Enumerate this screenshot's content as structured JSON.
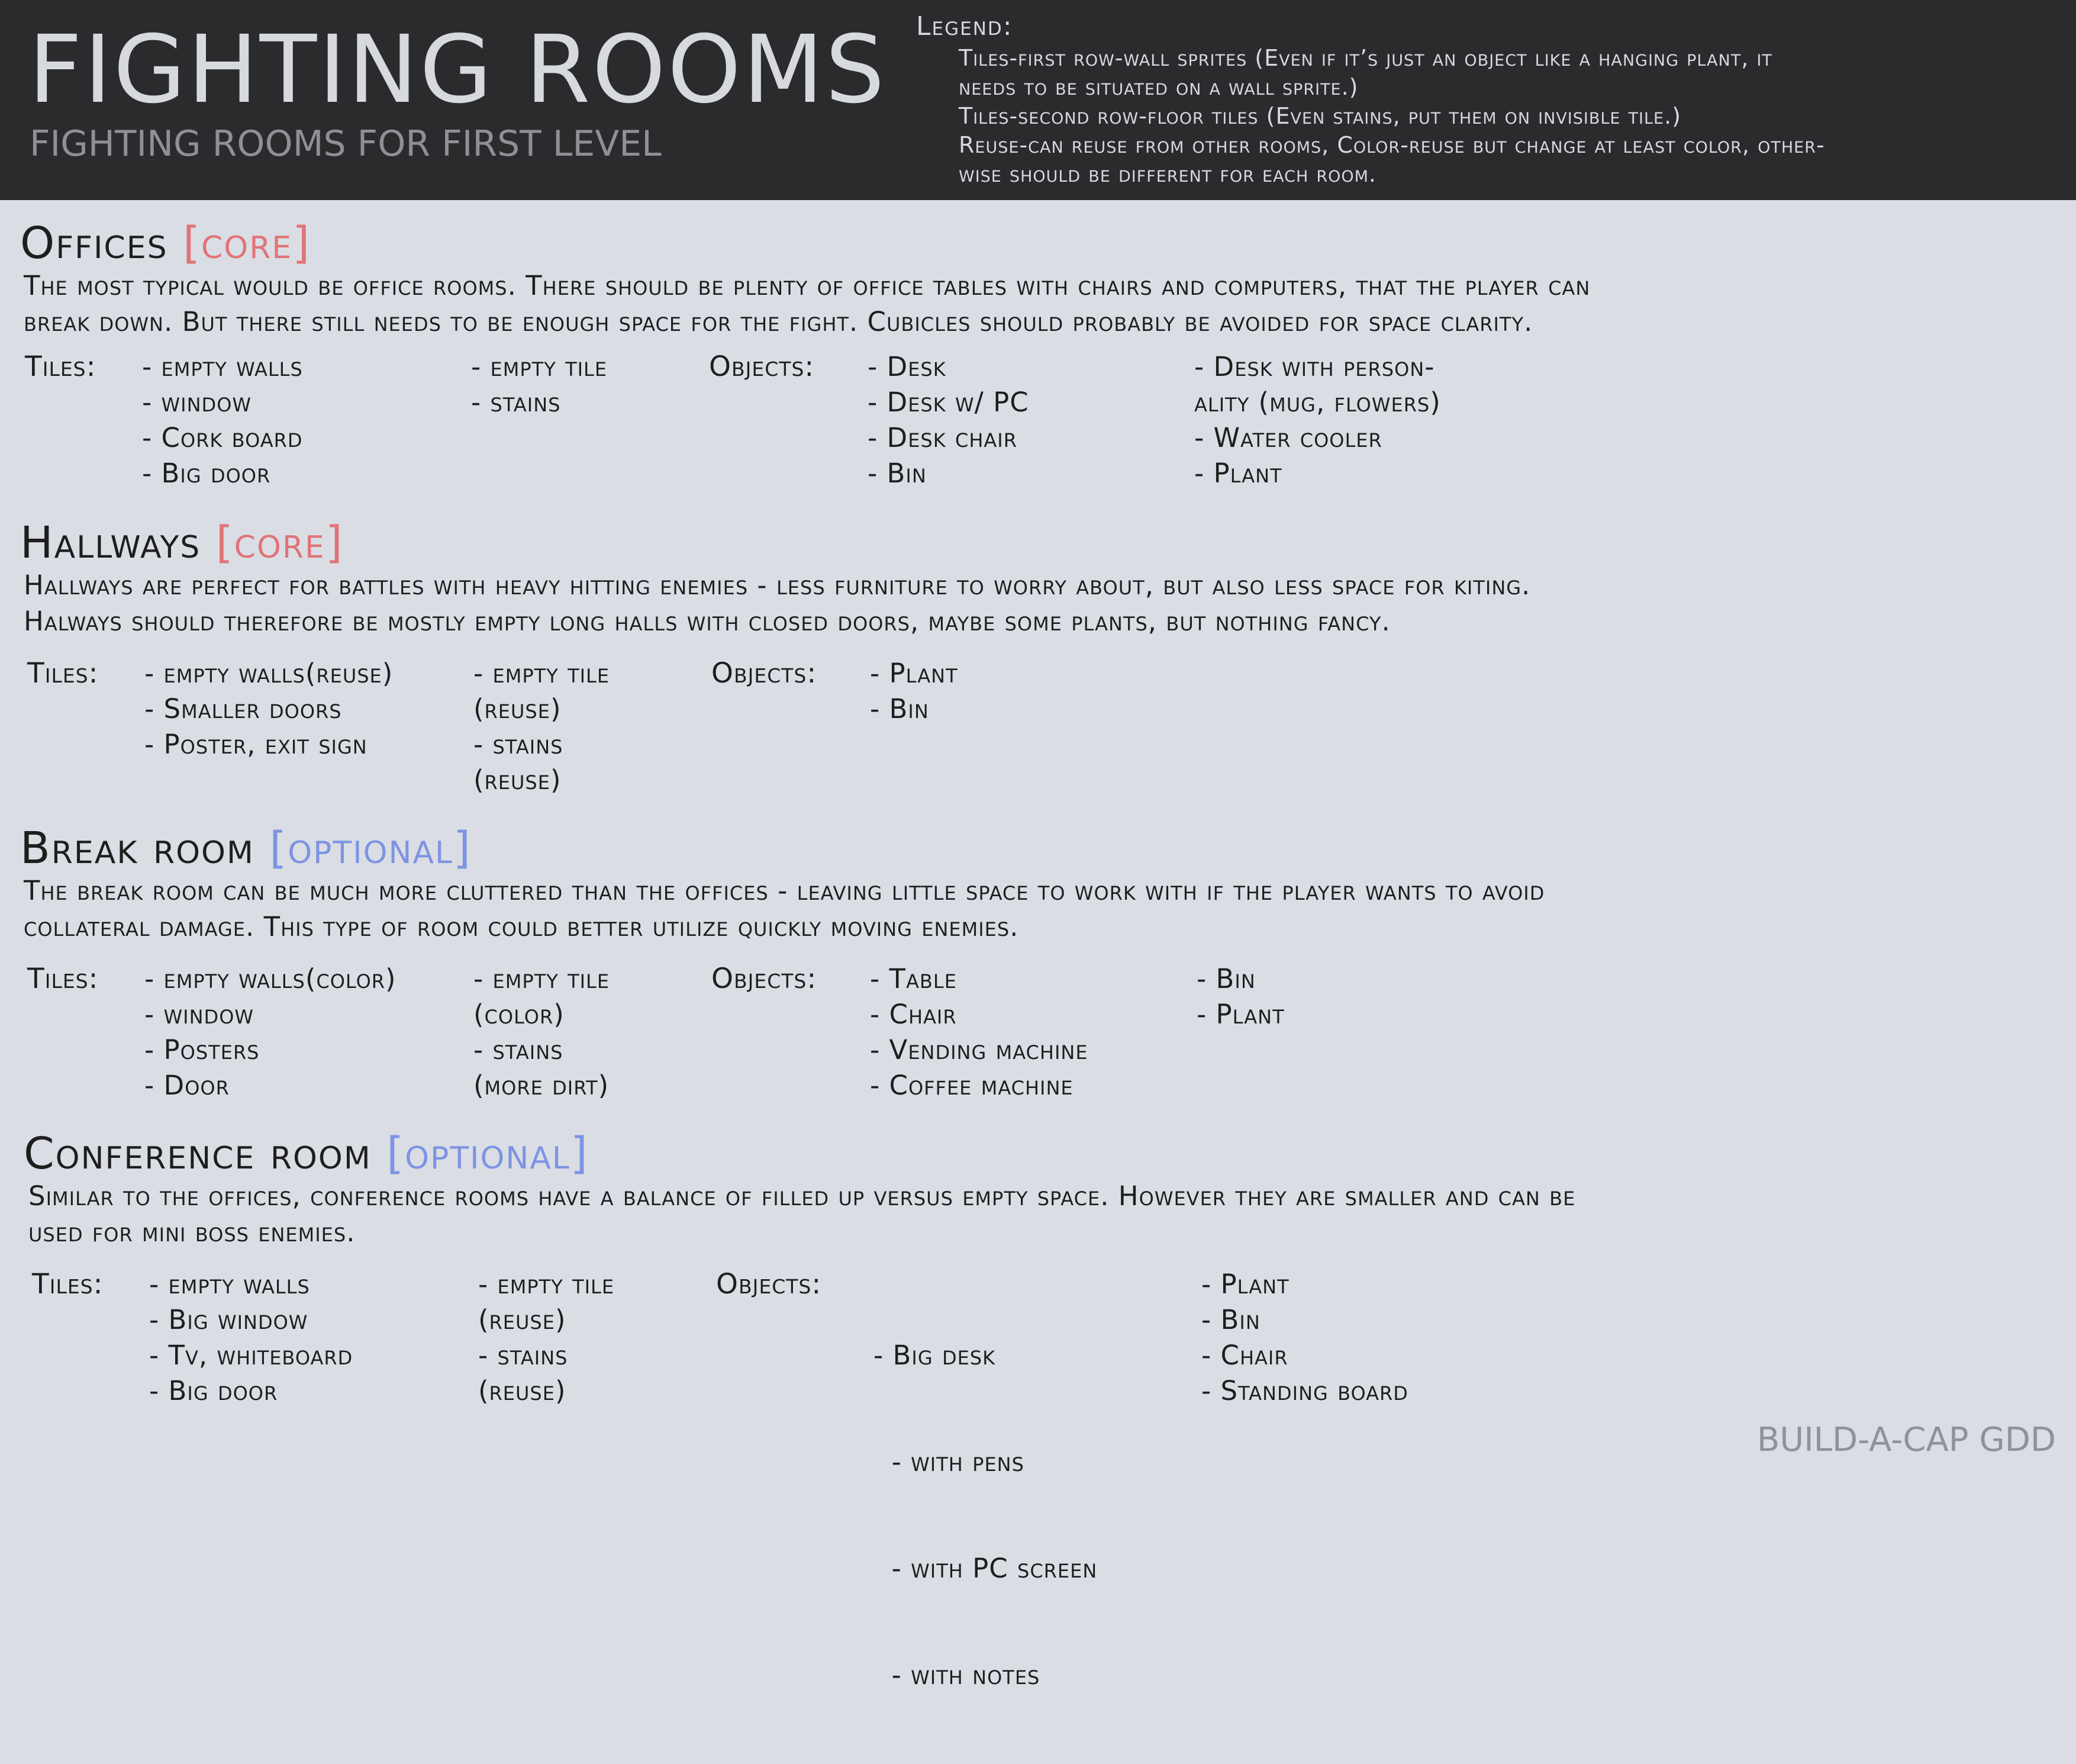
{
  "header": {
    "title": "FIGHTING ROOMS",
    "subtitle": "FIGHTING ROOMS FOR FIRST LEVEL",
    "legend_title": "Legend:",
    "legend_lines": [
      "Tiles-first row-wall sprites (Even if it’s just an object like a hanging plant, it",
      "needs to be situated on a wall sprite.)",
      "Tiles-second row-floor tiles (Even stains, put them on invisible tile.)",
      "Reuse-can reuse from other rooms, Color-reuse but change at least color, other-",
      "wise should be different for each room."
    ]
  },
  "labels": {
    "tiles": "Tiles:",
    "objects": "Objects:"
  },
  "colors": {
    "header_bg": "#2b2b2d",
    "page_bg": "#dadee4",
    "core_tag": "#e07478",
    "optional_tag": "#7e94e2"
  },
  "sections": [
    {
      "title": "Offices",
      "tag": "[core]",
      "description": [
        "The most typical would be office rooms. There should be plenty of office tables with chairs and computers, that the player can",
        "break down. But there still needs to be enough space for the fight. Cubicles should probably be avoided for space clarity."
      ],
      "tiles_walls": [
        "- empty walls",
        "- window",
        "- Cork board",
        "- Big door"
      ],
      "tiles_floor": [
        "- empty tile",
        "- stains"
      ],
      "objects_col1": [
        "- Desk",
        "- Desk w/ PC",
        "- Desk chair",
        "- Bin"
      ],
      "objects_col2": [
        "- Desk with person-",
        "ality (mug, flowers)",
        "- Water cooler",
        "- Plant"
      ]
    },
    {
      "title": "Hallways",
      "tag": "[core]",
      "description": [
        "Hallways are perfect for battles with heavy hitting enemies - less furniture to worry about, but also less space for kiting.",
        "Halways should therefore be mostly empty long halls with closed doors, maybe some plants, but nothing fancy."
      ],
      "tiles_walls": [
        "- empty walls(reuse)",
        "- Smaller doors",
        "- Poster, exit sign"
      ],
      "tiles_floor": [
        "- empty tile",
        "(reuse)",
        "- stains",
        "(reuse)"
      ],
      "objects_col1": [
        "- Plant",
        "- Bin"
      ],
      "objects_col2": []
    },
    {
      "title": "Break room",
      "tag": "[optional]",
      "description": [
        "The break room can be much more cluttered than the offices - leaving little space to work with if the player wants to avoid",
        "collateral damage. This type of room could better utilize quickly moving enemies."
      ],
      "tiles_walls": [
        "- empty walls(color)",
        "- window",
        "- Posters",
        "- Door"
      ],
      "tiles_floor": [
        "- empty tile",
        "(color)",
        "- stains",
        "(more dirt)"
      ],
      "objects_col1": [
        "- Table",
        "- Chair",
        "- Vending machine",
        "- Coffee machine"
      ],
      "objects_col2": [
        "- Bin",
        "- Plant"
      ]
    },
    {
      "title": "Conference room",
      "tag": "[optional]",
      "description": [
        "Similar to the offices, conference rooms have a balance of filled up versus empty space. However they are smaller and can be",
        "used for mini boss enemies."
      ],
      "tiles_walls": [
        "- empty walls",
        "- Big window",
        "- Tv, whiteboard",
        "- Big door"
      ],
      "tiles_floor": [
        "- empty tile",
        "(reuse)",
        "- stains",
        "(reuse)"
      ],
      "objects_col1": [
        "- Big desk",
        "  - with pens",
        "  - with PC screen",
        "  - with notes"
      ],
      "objects_col2": [
        "- Plant",
        "- Bin",
        "- Chair",
        "- Standing board"
      ]
    }
  ],
  "footer": "BUILD-A-CAP GDD"
}
